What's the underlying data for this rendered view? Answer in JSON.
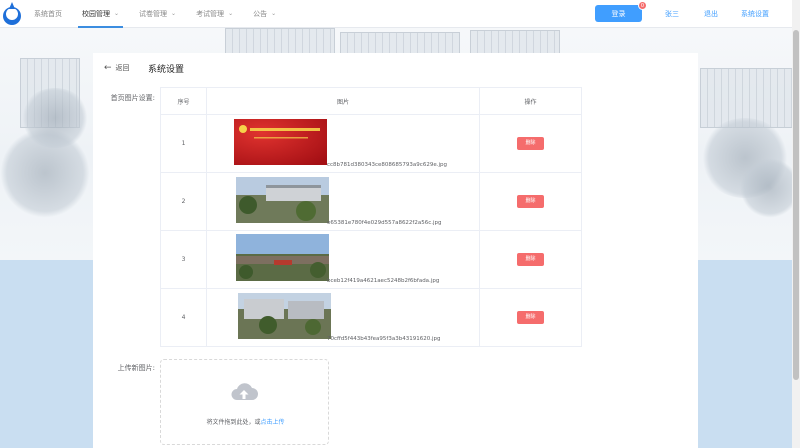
{
  "nav": {
    "items": [
      {
        "label": "系统首页",
        "dropdown": false
      },
      {
        "label": "校园管理",
        "dropdown": true
      },
      {
        "label": "试卷管理",
        "dropdown": true
      },
      {
        "label": "考试管理",
        "dropdown": true
      },
      {
        "label": "公告",
        "dropdown": true
      }
    ],
    "active_index": 1
  },
  "header": {
    "login_button": "登录",
    "badge_count": "0",
    "user_link": "张三",
    "logout_link": "退出",
    "settings_link": "系统设置"
  },
  "page": {
    "back_label": "返回",
    "title": "系统设置",
    "home_images_label": "首页图片设置:",
    "upload_label": "上传新图片:"
  },
  "table": {
    "headers": [
      "序号",
      "图片",
      "操作"
    ],
    "rows": [
      {
        "index": "1",
        "file": "cc8b781d380343ce808685793a9c629e.jpg",
        "image": "red-banner",
        "action": "删除"
      },
      {
        "index": "2",
        "file": "e65381e780f4e029d557a8622f2a56c.jpg",
        "image": "campus-photo",
        "action": "删除"
      },
      {
        "index": "3",
        "file": "bceb12f419a4621aec5248b2f6bfada.jpg",
        "image": "campus-photo",
        "action": "删除"
      },
      {
        "index": "4",
        "file": "70cffd5f443b43fea95f3a3b43191620.jpg",
        "image": "campus-photo",
        "action": "删除"
      }
    ]
  },
  "upload": {
    "hint": "将文件拖到此处，或",
    "link": "点击上传",
    "icon": "cloud-upload-icon"
  },
  "colors": {
    "primary": "#409eff",
    "danger": "#f56c6c",
    "banner_red": "#c8161d"
  }
}
